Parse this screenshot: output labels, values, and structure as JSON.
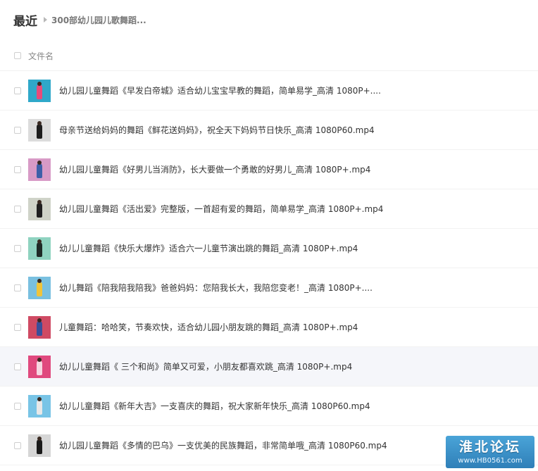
{
  "breadcrumb": {
    "root": "最近",
    "current": "300部幼儿园儿歌舞蹈..."
  },
  "header": {
    "column_name": "文件名"
  },
  "files": [
    {
      "name": "幼儿园儿童舞蹈《早发白帝城》适合幼儿宝宝早教的舞蹈，简单易学_高清 1080P+....",
      "thumb_bg": "#2fa8c9",
      "thumb_fg": "#e94b7a"
    },
    {
      "name": "母亲节送给妈妈的舞蹈《鲜花送妈妈》，祝全天下妈妈节日快乐_高清 1080P60.mp4",
      "thumb_bg": "#dcdcdc",
      "thumb_fg": "#1e1e1e"
    },
    {
      "name": "幼儿园儿童舞蹈《好男儿当消防》，长大要做一个勇敢的好男儿_高清 1080P+.mp4",
      "thumb_bg": "#d89ac6",
      "thumb_fg": "#3e5fa8"
    },
    {
      "name": "幼儿园儿童舞蹈《活出爱》完整版，一首超有爱的舞蹈，简单易学_高清 1080P+.mp4",
      "thumb_bg": "#cfd3c8",
      "thumb_fg": "#202020"
    },
    {
      "name": "幼儿儿童舞蹈《快乐大爆炸》适合六一儿童节演出跳的舞蹈_高清 1080P+.mp4",
      "thumb_bg": "#8fd3c0",
      "thumb_fg": "#1e2a26"
    },
    {
      "name": "幼儿舞蹈《陪我陪我陪我》爸爸妈妈：您陪我长大，我陪您变老！_高清 1080P+....",
      "thumb_bg": "#79c0e0",
      "thumb_fg": "#f0c43a"
    },
    {
      "name": "儿童舞蹈：哈哈笑，节奏欢快，适合幼儿园小朋友跳的舞蹈_高清 1080P+.mp4",
      "thumb_bg": "#cf4a63",
      "thumb_fg": "#3a4f9a"
    },
    {
      "name": "幼儿儿童舞蹈《 三个和尚》简单又可爱，小朋友都喜欢跳_高清 1080P+.mp4",
      "thumb_bg": "#e0497e",
      "thumb_fg": "#f6d7e2"
    },
    {
      "name": "幼儿儿童舞蹈《新年大吉》一支喜庆的舞蹈，祝大家新年快乐_高清 1080P60.mp4",
      "thumb_bg": "#78c4e6",
      "thumb_fg": "#e8e8e8"
    },
    {
      "name": "幼儿园儿童舞蹈《多情的巴乌》一支优美的民族舞蹈，非常简单哦_高清 1080P60.mp4",
      "thumb_bg": "#d6d6d6",
      "thumb_fg": "#1a1a1a"
    }
  ],
  "watermark": {
    "title": "淮北论坛",
    "subtitle": "www.HB0561.com"
  },
  "colors": {
    "accent_watermark": "#3a93cc",
    "hover_row": "#f5f6fa"
  }
}
